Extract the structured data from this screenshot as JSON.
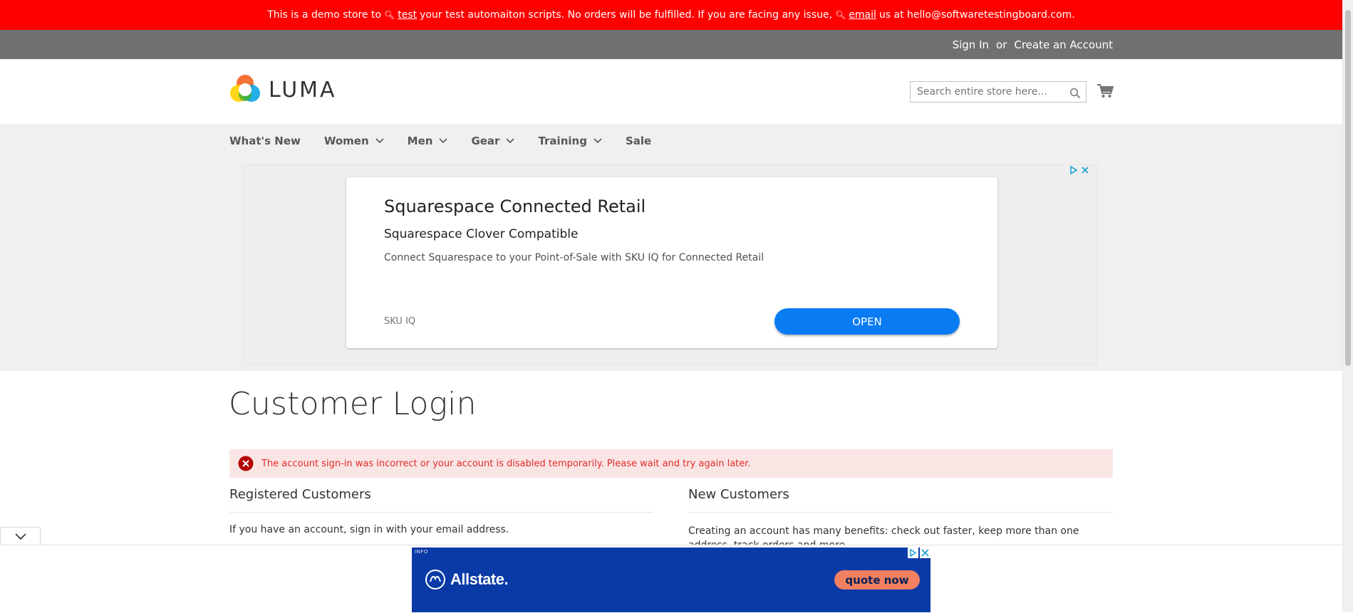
{
  "demo_notice": {
    "part1": "This is a demo store to",
    "link1": "test",
    "part2": "your test automaiton scripts. No orders will be fulfilled. If you are facing any issue,",
    "link2": "email",
    "part3": "us at hello@softwaretestingboard.com."
  },
  "header": {
    "sign_in": "Sign In",
    "or": "or",
    "create_account": "Create an Account"
  },
  "logo": {
    "text": "LUMA"
  },
  "search": {
    "placeholder": "Search entire store here..."
  },
  "nav": {
    "items": [
      {
        "label": "What's New",
        "has_submenu": false
      },
      {
        "label": "Women",
        "has_submenu": true
      },
      {
        "label": "Men",
        "has_submenu": true
      },
      {
        "label": "Gear",
        "has_submenu": true
      },
      {
        "label": "Training",
        "has_submenu": true
      },
      {
        "label": "Sale",
        "has_submenu": false
      }
    ]
  },
  "ad": {
    "title": "Squarespace Connected Retail",
    "subtitle": "Squarespace Clover Compatible",
    "description": "Connect Squarespace to your Point-of-Sale with SKU IQ for Connected Retail",
    "brand": "SKU IQ",
    "cta": "OPEN"
  },
  "page": {
    "title": "Customer Login",
    "error": "The account sign-in was incorrect or your account is disabled temporarily. Please wait and try again later."
  },
  "registered": {
    "title": "Registered Customers",
    "text": "If you have an account, sign in with your email address."
  },
  "new_customers": {
    "title": "New Customers",
    "text": "Creating an account has many benefits: check out faster, keep more than one address, track orders and more."
  },
  "bottom_ad": {
    "info": "INFO",
    "brand": "Allstate.",
    "cta": "quote now"
  },
  "colors": {
    "demo_banner": "#ff0000",
    "header_bar": "#6e716e",
    "error_bg": "#fae5e5",
    "error_text": "#e02b27",
    "ad_button": "#0a7cf3",
    "allstate_bg": "#0a3aa6"
  }
}
